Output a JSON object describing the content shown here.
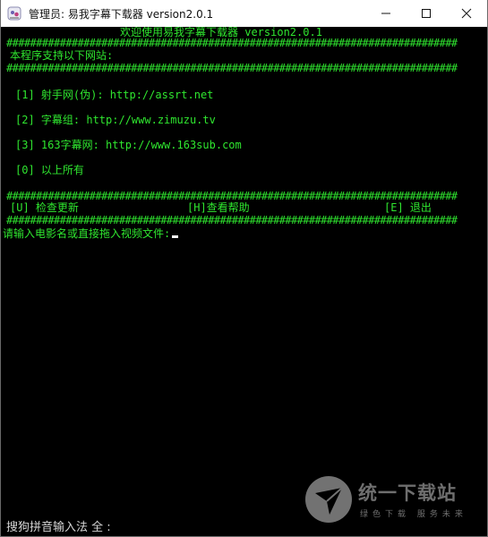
{
  "window": {
    "title": "管理员:  易我字幕下载器 version2.0.1",
    "controls": {
      "minimize": "minimize-icon",
      "maximize": "maximize-icon",
      "close": "close-icon"
    }
  },
  "console": {
    "header": "欢迎使用易我字幕下载器 version2.0.1",
    "separator": "############################################################################",
    "sites_heading": "本程序支持以下网站:",
    "sites": [
      "[1] 射手网(伪): http://assrt.net",
      "[2] 字幕组: http://www.zimuzu.tv",
      "[3] 163字幕网: http://www.163sub.com",
      "[0] 以上所有"
    ],
    "menu": {
      "update": "[U] 检查更新",
      "help": "[H]查看帮助",
      "exit": "[E] 退出"
    },
    "prompt": "请输入电影名或直接拖入视频文件:"
  },
  "ime": {
    "status": "搜狗拼音输入法 全 :"
  },
  "watermark": {
    "name": "统一下载站",
    "tagline": "绿色下载 服务未来"
  },
  "colors": {
    "console_text": "#2fe62f",
    "console_bg": "#000000"
  }
}
